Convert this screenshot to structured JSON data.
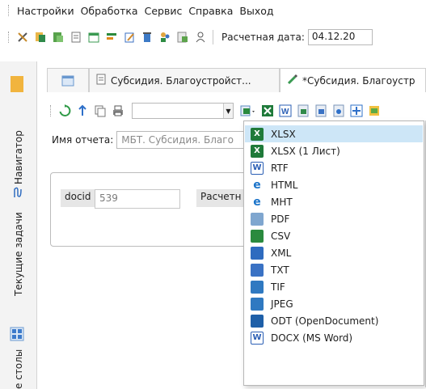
{
  "menu": {
    "items": [
      "Настройки",
      "Обработка",
      "Сервис",
      "Справка",
      "Выход"
    ]
  },
  "toolbar": {
    "date_label": "Расчетная дата:",
    "date_value": "04.12.20"
  },
  "side": {
    "navigator": "Навигатор",
    "tasks": "Текущие задачи",
    "desks": "е столы"
  },
  "tabs": [
    {
      "label": "Субсидия. Благоустройст..."
    },
    {
      "label": "*Субсидия. Благоустр"
    }
  ],
  "report": {
    "name_label": "Имя отчета:",
    "name_value": "МБТ. Субсидия. Благо",
    "docid_label": "docid",
    "docid_value": "539",
    "calc_label": "Расчетн"
  },
  "export_menu": {
    "items": [
      {
        "label": "XLSX",
        "icon": "excel-icon",
        "color": "#1f7a3a"
      },
      {
        "label": "XLSX (1 Лист)",
        "icon": "excel-icon",
        "color": "#1f7a3a"
      },
      {
        "label": "RTF",
        "icon": "word-icon",
        "color": "#2b5fb5"
      },
      {
        "label": "HTML",
        "icon": "ie-icon",
        "color": "#1a73c9"
      },
      {
        "label": "MHT",
        "icon": "ie-icon",
        "color": "#1a73c9"
      },
      {
        "label": "PDF",
        "icon": "pdf-icon",
        "color": "#7fa6cf"
      },
      {
        "label": "CSV",
        "icon": "csv-icon",
        "color": "#2a8a3e"
      },
      {
        "label": "XML",
        "icon": "xml-icon",
        "color": "#2e6bbf"
      },
      {
        "label": "TXT",
        "icon": "txt-icon",
        "color": "#3a72c4"
      },
      {
        "label": "TIF",
        "icon": "image-icon",
        "color": "#2f79c1"
      },
      {
        "label": "JPEG",
        "icon": "image-icon",
        "color": "#2f79c1"
      },
      {
        "label": "ODT (OpenDocument)",
        "icon": "odt-icon",
        "color": "#1e5fa8"
      },
      {
        "label": "DOCX (MS Word)",
        "icon": "word-icon",
        "color": "#2b5fb5"
      }
    ],
    "selected_index": 0
  },
  "colors": {
    "accent": "#cde6f7",
    "excel": "#1f7a3a",
    "word": "#2b5fb5"
  }
}
